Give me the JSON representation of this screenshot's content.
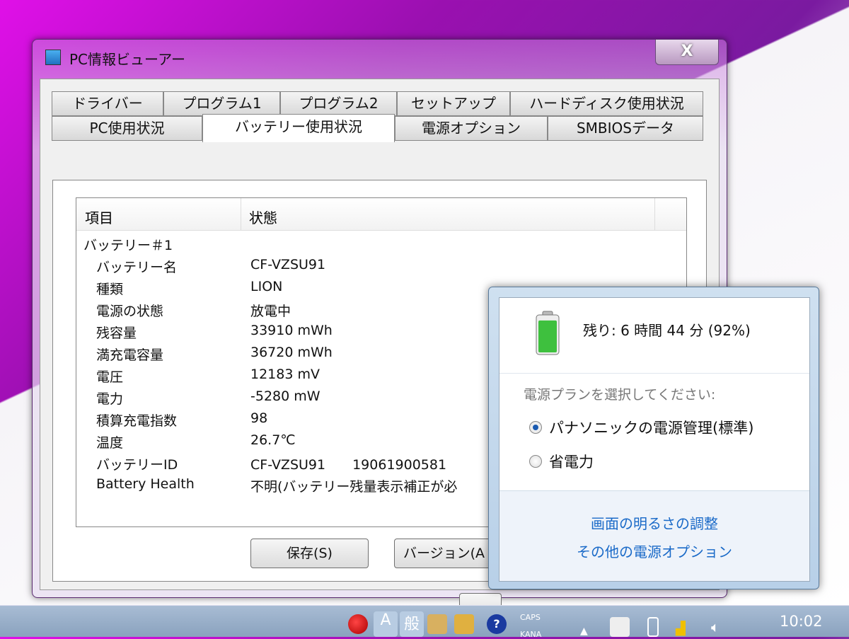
{
  "window": {
    "title": "PC情報ビューアー",
    "close_label": "X"
  },
  "tabs_row1": [
    "ドライバー",
    "プログラム1",
    "プログラム2",
    "セットアップ",
    "ハードディスク使用状況"
  ],
  "tabs_row2": [
    "PC使用状況",
    "バッテリー使用状況",
    "電源オプション",
    "SMBIOSデータ"
  ],
  "list": {
    "headers": [
      "項目",
      "状態"
    ],
    "group": "バッテリー＃1",
    "rows": [
      {
        "label": "バッテリー名",
        "value": "CF-VZSU91"
      },
      {
        "label": "種類",
        "value": "LION"
      },
      {
        "label": "電源の状態",
        "value": "放電中"
      },
      {
        "label": "残容量",
        "value": "33910 mWh"
      },
      {
        "label": "満充電容量",
        "value": "36720 mWh"
      },
      {
        "label": "電圧",
        "value": "12183 mV"
      },
      {
        "label": "電力",
        "value": "-5280 mW"
      },
      {
        "label": "積算充電指数",
        "value": "98"
      },
      {
        "label": "温度",
        "value": "26.7℃"
      },
      {
        "label": "バッテリーID",
        "value": "CF-VZSU91　　19061900581"
      },
      {
        "label": "Battery Health",
        "value": "不明(バッテリー残量表示補正が必"
      }
    ]
  },
  "buttons": {
    "save": "保存(S)",
    "version": "バージョン(A"
  },
  "battery_popup": {
    "remaining": "残り: 6 時間 44 分 (92%)",
    "percent": 92,
    "plan_prompt": "電源プランを選択してください:",
    "plans": [
      {
        "label": "パナソニックの電源管理(標準)",
        "selected": true
      },
      {
        "label": "省電力",
        "selected": false
      }
    ],
    "links": [
      "画面の明るさの調整",
      "その他の電源オプション"
    ]
  },
  "taskbar": {
    "ime_mode": "A",
    "ime_kanji": "般",
    "caps": "CAPS",
    "kana": "KANA",
    "clock": "10:02"
  }
}
